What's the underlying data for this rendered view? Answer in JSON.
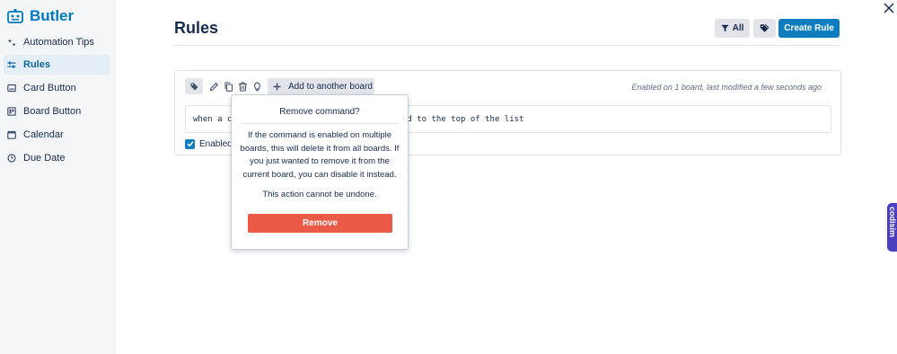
{
  "brand": {
    "name": "Butler",
    "icon": "butler-robot-icon",
    "color": "#0079bf"
  },
  "sidebar": {
    "items": [
      {
        "label": "Automation Tips",
        "icon": "sparkle-icon"
      },
      {
        "label": "Rules",
        "icon": "sliders-icon",
        "active": true
      },
      {
        "label": "Card Button",
        "icon": "card-icon"
      },
      {
        "label": "Board Button",
        "icon": "board-icon"
      },
      {
        "label": "Calendar",
        "icon": "calendar-icon"
      },
      {
        "label": "Due Date",
        "icon": "clock-icon"
      }
    ]
  },
  "header": {
    "title": "Rules",
    "filter_label": "All",
    "create_label": "Create Rule"
  },
  "rule": {
    "add_board_label": "Add to another board",
    "meta": "Enabled on 1 board, last modified a few seconds ago",
    "command_visible": "when a c                              he card to the top of the list",
    "enabled_label": "Enabled",
    "enabled": true
  },
  "popover": {
    "title": "Remove command?",
    "body": "If the command is enabled on multiple boards, this will delete it from all boards. If you just wanted to remove it from the current board, you can disable it instead.",
    "warning": "This action cannot be undone.",
    "remove_label": "Remove"
  },
  "side_widget": {
    "label": "codisim"
  },
  "colors": {
    "primary": "#0c7dbf",
    "danger": "#eb5a46",
    "sidebar_bg": "#f4f5f7",
    "active_item_bg": "#e4eef5",
    "widget": "#4a3fbf"
  }
}
